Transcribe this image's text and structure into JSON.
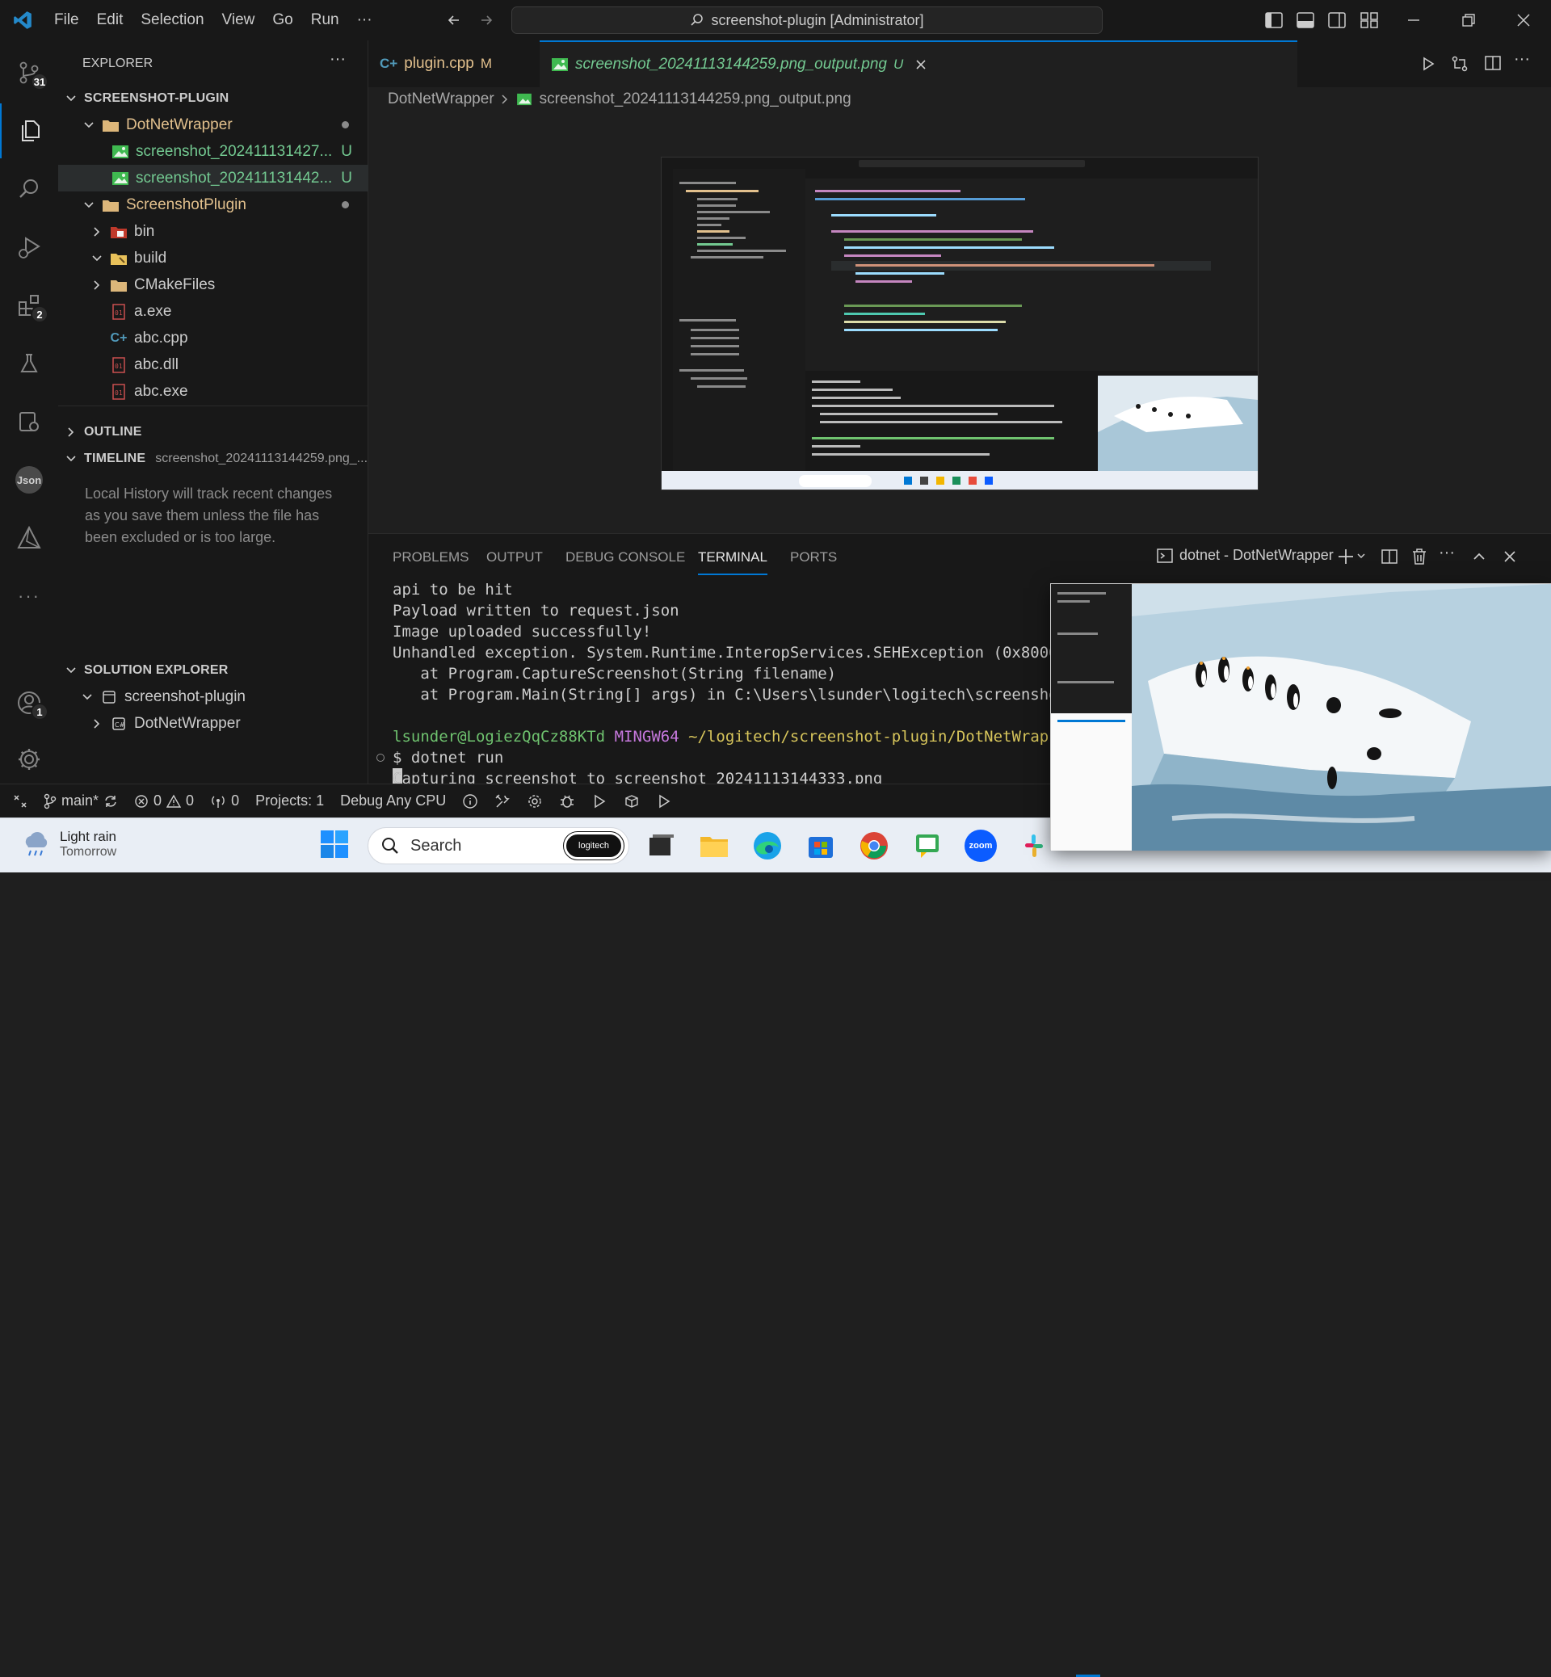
{
  "titlebar": {
    "menus": [
      "File",
      "Edit",
      "Selection",
      "View",
      "Go",
      "Run",
      "···"
    ],
    "command_center": "screenshot-plugin [Administrator]"
  },
  "activity": {
    "scm_badge": "31",
    "extensions_badge": "2",
    "accounts_badge": "1",
    "json_label": "Json"
  },
  "sidebar": {
    "title": "EXPLORER",
    "more": "···",
    "root": "SCREENSHOT-PLUGIN",
    "tree": [
      {
        "label": "DotNetWrapper",
        "status": ""
      },
      {
        "label": "screenshot_202411131427...",
        "status": "U"
      },
      {
        "label": "screenshot_202411131442...",
        "status": "U"
      },
      {
        "label": "ScreenshotPlugin",
        "status": ""
      },
      {
        "label": "bin",
        "status": ""
      },
      {
        "label": "build",
        "status": ""
      },
      {
        "label": "CMakeFiles",
        "status": ""
      },
      {
        "label": "a.exe",
        "status": ""
      },
      {
        "label": "abc.cpp",
        "status": ""
      },
      {
        "label": "abc.dll",
        "status": ""
      },
      {
        "label": "abc.exe",
        "status": ""
      }
    ],
    "outline": "OUTLINE",
    "timeline": "TIMELINE",
    "timeline_file": "screenshot_20241113144259.png_...",
    "timeline_message": "Local History will track recent changes as you save them unless the file has been excluded or is too large.",
    "solution_explorer": "SOLUTION EXPLORER",
    "solution_items": [
      "screenshot-plugin",
      "DotNetWrapper"
    ]
  },
  "tabs": [
    {
      "icon": "C+",
      "label": "plugin.cpp",
      "status": "M"
    },
    {
      "label": "screenshot_20241113144259.png_output.png",
      "status": "U"
    }
  ],
  "breadcrumbs": [
    "DotNetWrapper",
    "screenshot_20241113144259.png_output.png"
  ],
  "panel": {
    "tabs": [
      "PROBLEMS",
      "OUTPUT",
      "DEBUG CONSOLE",
      "TERMINAL",
      "PORTS"
    ],
    "terminal_name": "dotnet - DotNetWrapper",
    "lines": [
      "api to be hit",
      "Payload written to request.json",
      "Image uploaded successfully!",
      "Unhandled exception. System.Runtime.InteropServices.SEHException (0x800040",
      "   at Program.CaptureScreenshot(String filename)",
      "   at Program.Main(String[] args) in C:\\Users\\lsunder\\logitech\\screenshot-"
    ],
    "prompt_user": "lsunder@LogiezQqCz88KTd",
    "prompt_shell": "MINGW64",
    "prompt_path": "~/logitech/screenshot-plugin/DotNetWrapper",
    "command": "$ dotnet run",
    "output": "Capturing screenshot to screenshot_20241113144333.png"
  },
  "statusbar": {
    "branch": "main*",
    "errors": "0",
    "warnings": "0",
    "ports": "0",
    "projects": "Projects: 1",
    "config": "Debug Any CPU"
  },
  "taskbar": {
    "weather_title": "Light rain",
    "weather_sub": "Tomorrow",
    "search": "Search",
    "logitech_badge": "logitech",
    "zoom_label": "zoom"
  },
  "colors": {
    "accent": "#0078d4",
    "git_untracked": "#73c991",
    "git_modified": "#e2c08d",
    "prompt_user": "#6fc36f",
    "prompt_shell": "#c678dd",
    "prompt_path": "#d7c55b"
  }
}
